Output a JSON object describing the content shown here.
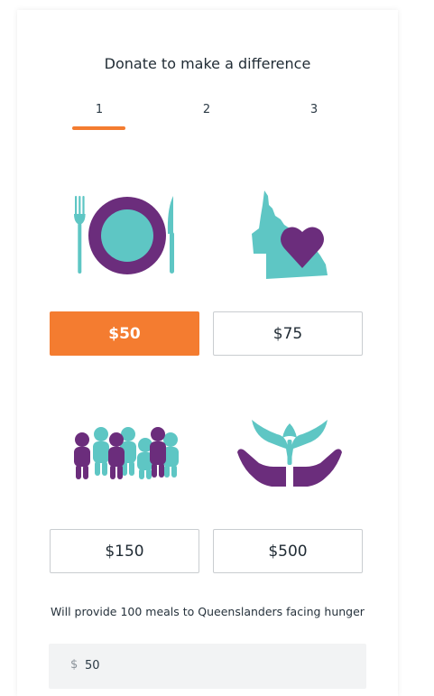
{
  "page": {
    "title": "Donate to make a difference"
  },
  "steps": [
    {
      "label": "1",
      "active": true
    },
    {
      "label": "2",
      "active": false
    },
    {
      "label": "3",
      "active": false
    }
  ],
  "amounts": [
    {
      "label": "$50",
      "selected": true,
      "icon": "plate-cutlery-icon"
    },
    {
      "label": "$75",
      "selected": false,
      "icon": "queensland-heart-icon"
    },
    {
      "label": "$150",
      "selected": false,
      "icon": "people-group-icon"
    },
    {
      "label": "$500",
      "selected": false,
      "icon": "hands-sprout-icon"
    }
  ],
  "impact_text": "Will provide 100 meals to Queenslanders facing hunger",
  "custom_amount": {
    "currency": "$",
    "value": "50"
  },
  "colors": {
    "accent": "#f47c30",
    "teal": "#5ec6c4",
    "purple": "#6b2d7c"
  }
}
